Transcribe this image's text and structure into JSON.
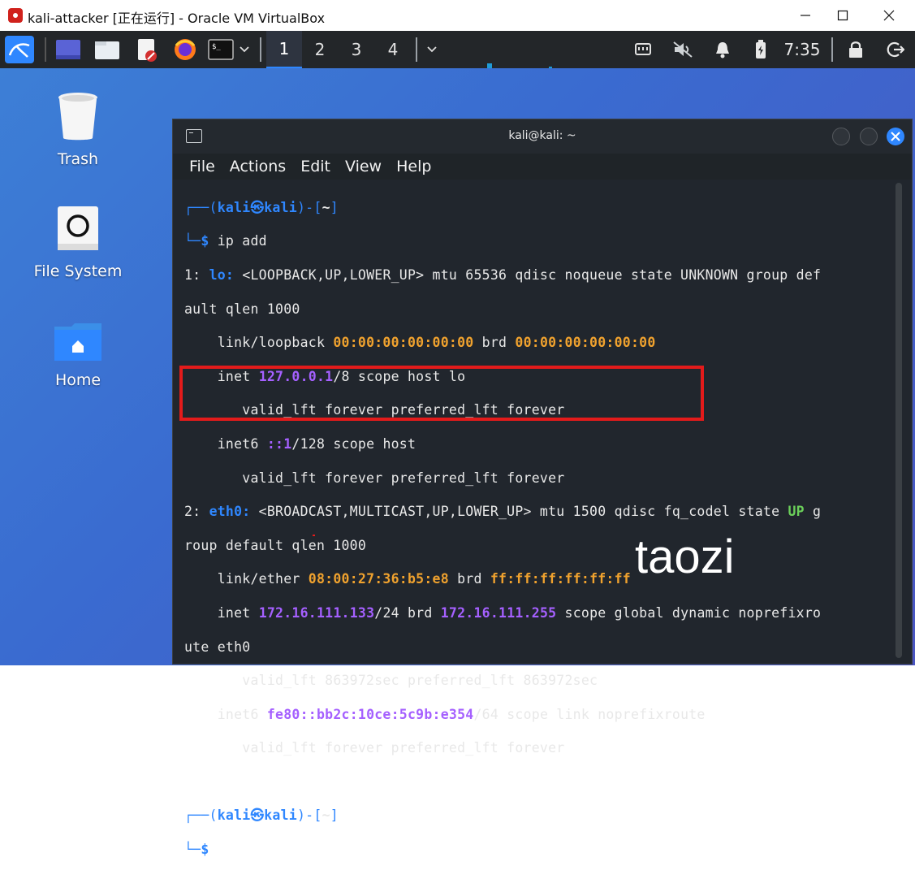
{
  "host_window": {
    "title": "kali-attacker [正在运行] - Oracle VM VirtualBox",
    "minimize": "—",
    "maximize": "☐",
    "close": "✕"
  },
  "panel": {
    "workspaces": [
      "1",
      "2",
      "3",
      "4"
    ],
    "active_workspace": "1",
    "clock": "7:35",
    "icons": [
      "kali-menu-icon",
      "show-desktop-icon",
      "file-manager-icon",
      "text-editor-icon",
      "firefox-icon",
      "terminal-icon",
      "network-icon",
      "volume-muted-icon",
      "notification-bell-icon",
      "battery-icon",
      "lock-icon",
      "logout-icon"
    ]
  },
  "desktop": {
    "icons": [
      {
        "label": "Trash"
      },
      {
        "label": "File System"
      },
      {
        "label": "Home"
      }
    ]
  },
  "terminal": {
    "title": "kali@kali: ~",
    "menu": [
      "File",
      "Actions",
      "Edit",
      "View",
      "Help"
    ],
    "prompt_user": "kali",
    "prompt_host": "kali",
    "prompt_dir": "~",
    "command": "ip add",
    "lo": {
      "index": "1:",
      "name": "lo:",
      "flags_line": "<LOOPBACK,UP,LOWER_UP> mtu 65536 qdisc noqueue state UNKNOWN group def",
      "wrap": "ault qlen 1000",
      "link_label": "link/loopback",
      "mac": "00:00:00:00:00:00",
      "brd_label": "brd",
      "brd": "00:00:00:00:00:00",
      "inet_label": "inet",
      "inet": "127.0.0.1",
      "inet_rest": "/8 scope host lo",
      "valid1": "valid_lft forever preferred_lft forever",
      "inet6_label": "inet6",
      "inet6": "::1",
      "inet6_rest": "/128 scope host",
      "valid2": "valid_lft forever preferred_lft forever"
    },
    "eth0": {
      "index": "2:",
      "name": "eth0:",
      "flags_line_a": "<BROADCAST,MULTICAST,UP,LOWER_UP> mtu 1500 qdisc fq_codel state",
      "state": "UP",
      "flags_line_b": "g",
      "wrap": "roup default qlen 1000",
      "link_label": "link/ether",
      "mac": "08:00:27:36:b5:e8",
      "brd_label": "brd",
      "brd": "ff:ff:ff:ff:ff:ff",
      "inet_label": "inet",
      "inet": "172.16.111.133",
      "inet_mid": "/24 brd",
      "inet_brd": "172.16.111.255",
      "inet_rest": "scope global dynamic noprefixro",
      "wrap2": "ute eth0",
      "valid1": "valid_lft 863972sec preferred_lft 863972sec",
      "inet6_label": "inet6",
      "inet6": "fe80::bb2c:10ce:5c9b:e354",
      "inet6_rest": "/64 scope link noprefixroute",
      "valid2": "valid_lft forever preferred_lft forever"
    }
  },
  "watermark": "taozi",
  "colors": {
    "panel_bg": "#232629",
    "terminal_bg": "#21262d",
    "accent_blue": "#2f87ff",
    "ip_purple": "#a560ff",
    "mac_yellow": "#f0a22e",
    "highlight_red": "#e31b1b"
  }
}
